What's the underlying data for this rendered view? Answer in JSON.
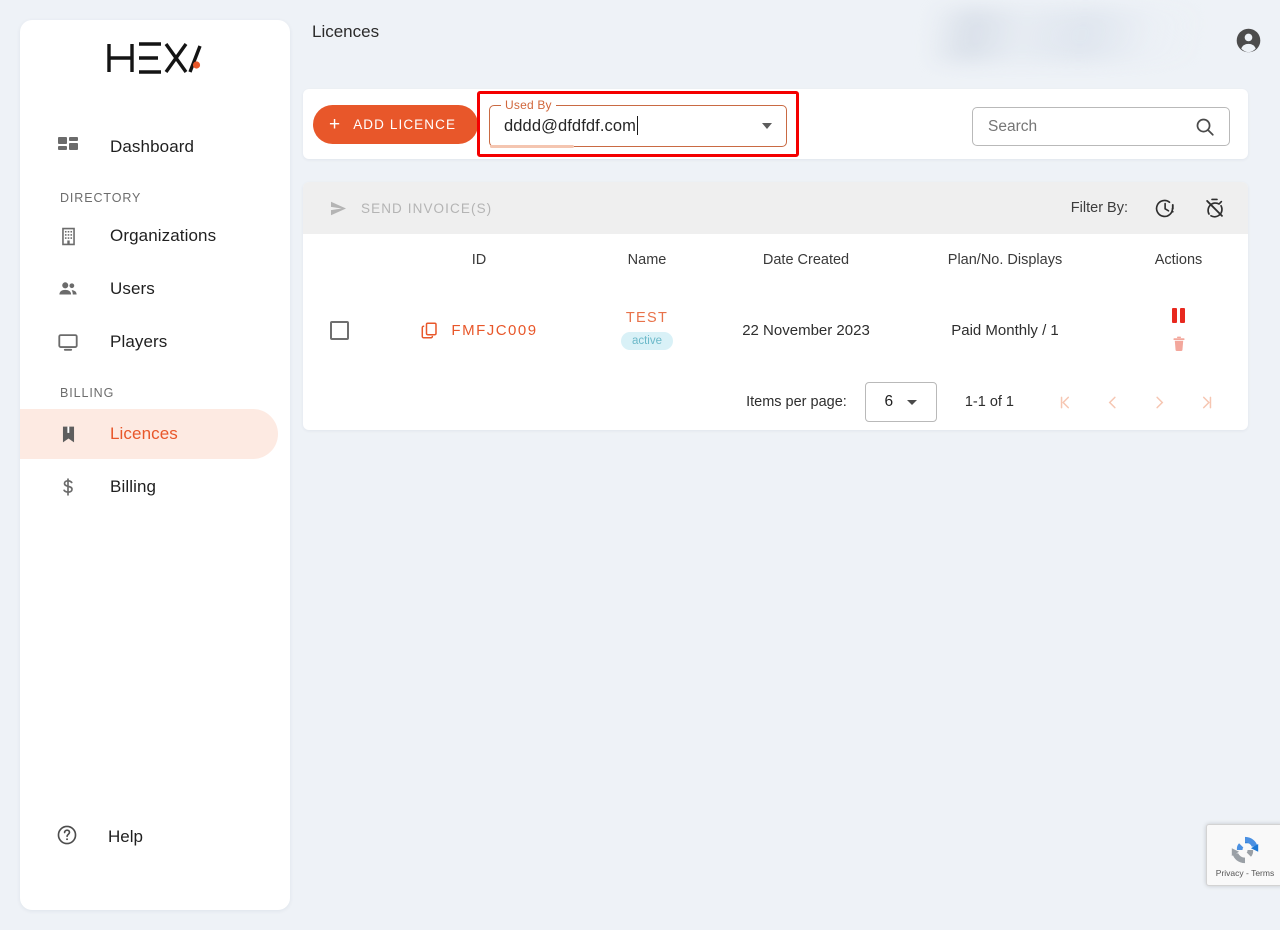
{
  "brand": {
    "logo_text": "HEXA",
    "accent_color": "#e8572a",
    "page_background": "#eef2f7"
  },
  "sidebar": {
    "dashboard": {
      "label": "Dashboard",
      "icon": "dashboard-grid-icon"
    },
    "sections": [
      {
        "title": "DIRECTORY",
        "items": [
          {
            "label": "Organizations",
            "icon": "building-icon",
            "active": false
          },
          {
            "label": "Users",
            "icon": "people-icon",
            "active": false
          },
          {
            "label": "Players",
            "icon": "monitor-icon",
            "active": false
          }
        ]
      },
      {
        "title": "BILLING",
        "items": [
          {
            "label": "Licences",
            "icon": "bookmark-icon",
            "active": true
          },
          {
            "label": "Billing",
            "icon": "dollar-icon",
            "active": false
          }
        ]
      }
    ],
    "help": {
      "label": "Help",
      "icon": "help-circle-icon"
    }
  },
  "header": {
    "title": "Licences",
    "avatar_icon": "account-circle-icon"
  },
  "toolbar": {
    "add_button": {
      "label": "ADD LICENCE",
      "plus": "+"
    },
    "used_by": {
      "legend": "Used By",
      "value": "dddd@dfdfdf.com",
      "highlighted": true,
      "highlight_color": "#f40000"
    },
    "search": {
      "placeholder": "Search",
      "value": "",
      "icon": "search-icon"
    }
  },
  "table": {
    "actions_bar": {
      "send_invoices_label": "SEND INVOICE(S)",
      "send_icon": "send-icon",
      "filter_label": "Filter By:",
      "filter_icons": [
        "clock-alert-icon",
        "timer-off-icon"
      ]
    },
    "columns": [
      "ID",
      "Name",
      "Date Created",
      "Plan/No. Displays",
      "Actions"
    ],
    "rows": [
      {
        "selected": false,
        "id": "FMFJC009",
        "copy_icon": "copy-icon",
        "name": "TEST",
        "status": "active",
        "date_created": "22 November 2023",
        "plan": "Paid Monthly / 1",
        "actions": [
          "pause-icon",
          "delete-icon"
        ]
      }
    ],
    "status_colors": {
      "badge_bg": "#d9f1f7",
      "badge_text": "#6cb9c9"
    }
  },
  "pagination": {
    "items_per_page_label": "Items per page:",
    "items_per_page_value": "6",
    "range_label": "1-1 of 1",
    "buttons": [
      "first-page",
      "previous-page",
      "next-page",
      "last-page"
    ]
  },
  "recaptcha": {
    "text": "Privacy - Terms"
  }
}
